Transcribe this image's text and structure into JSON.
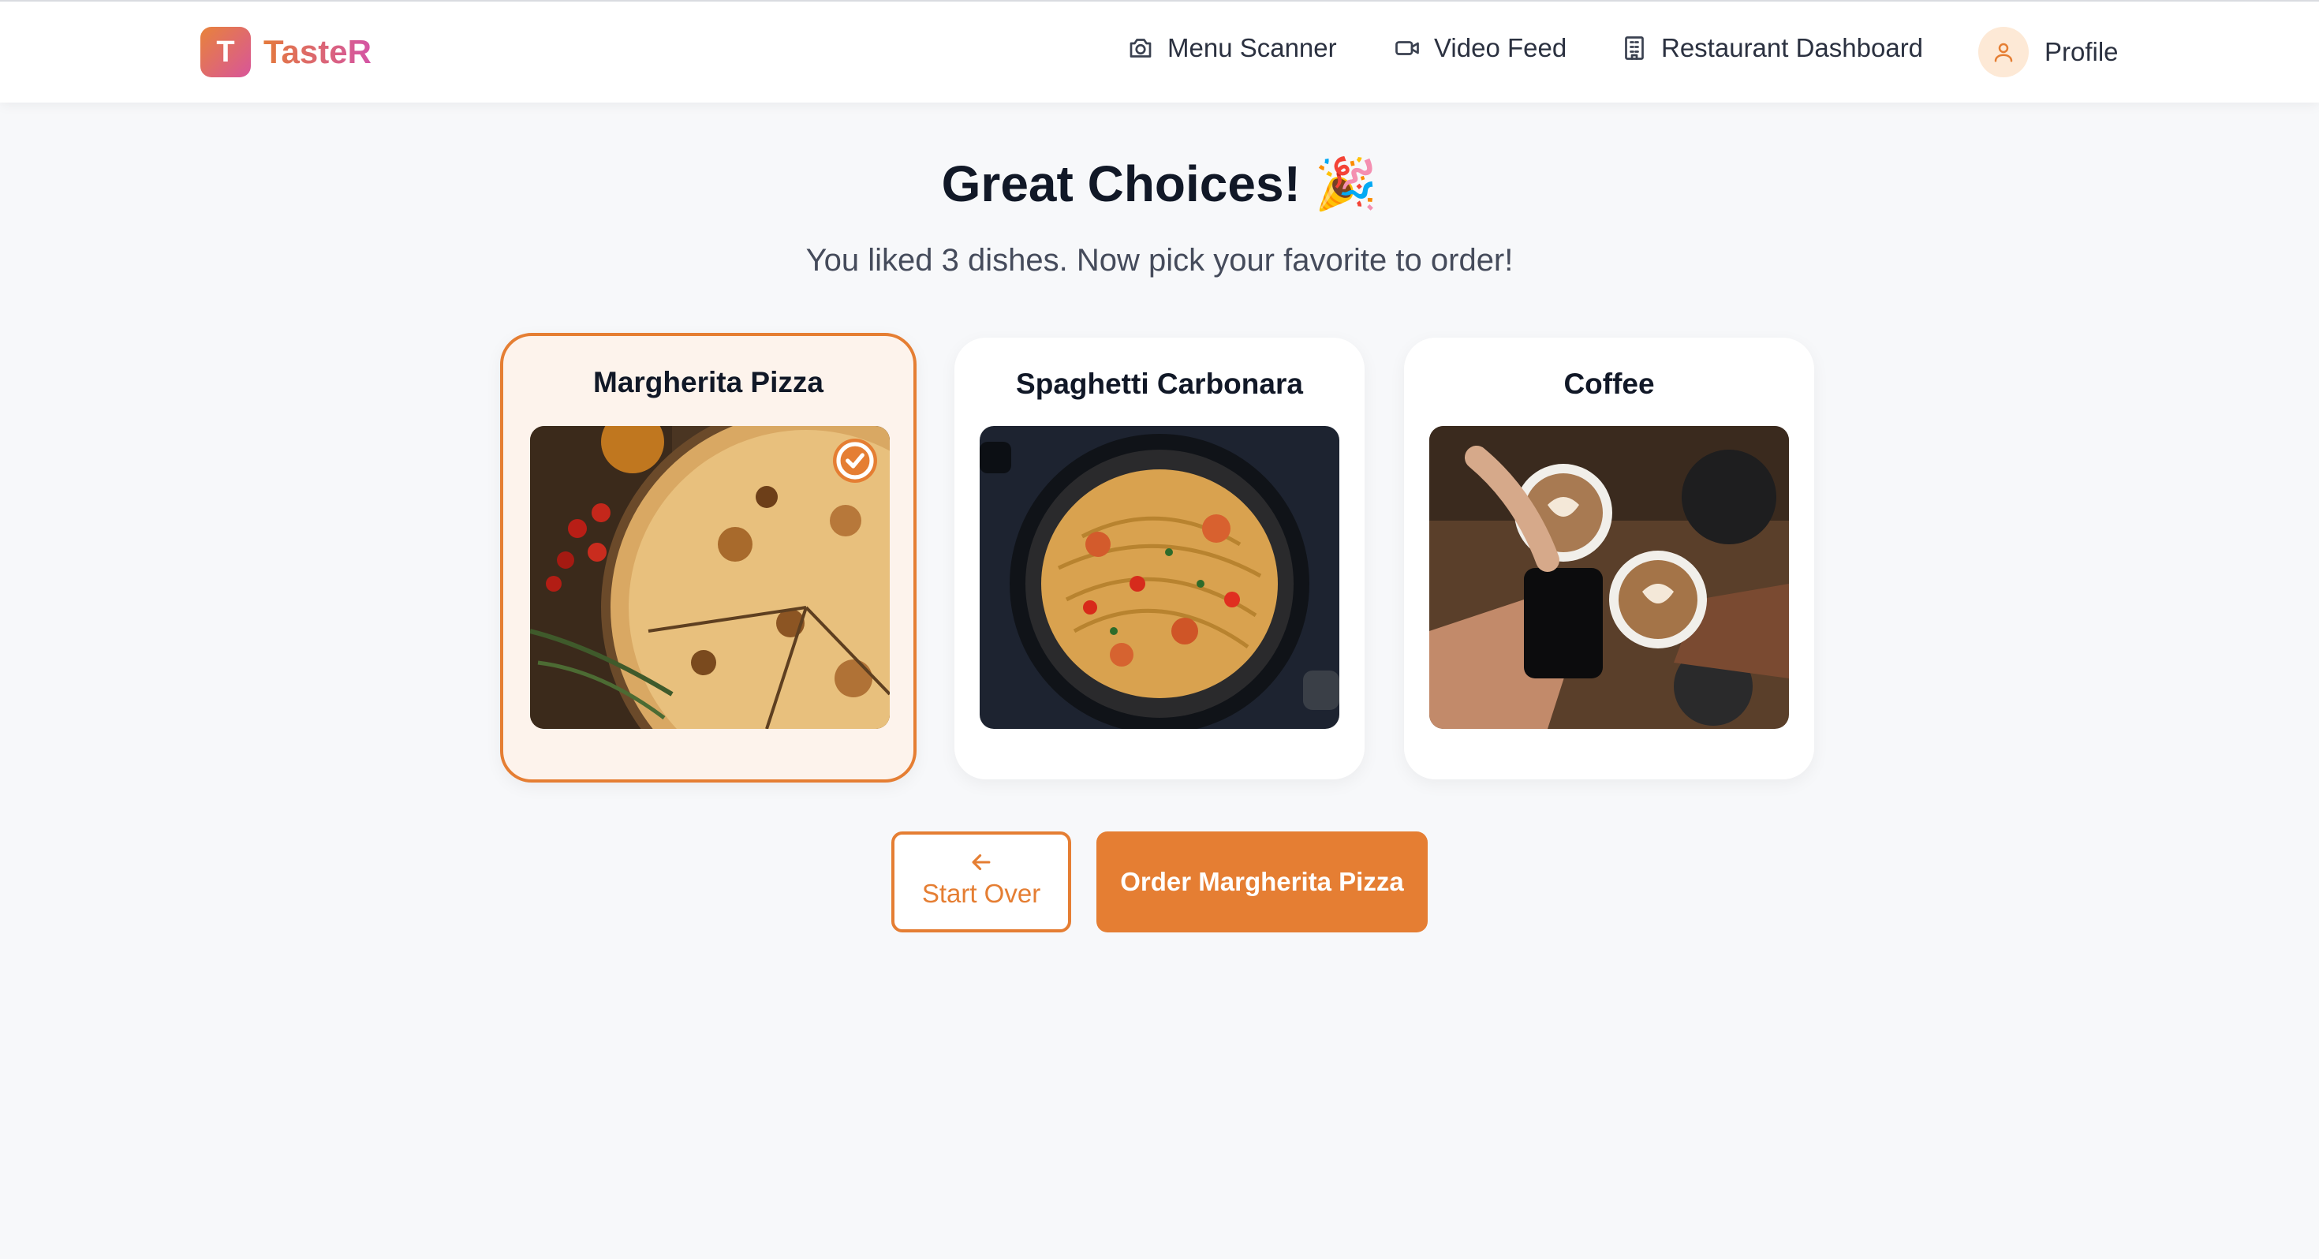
{
  "app": {
    "logo_letter": "T",
    "name": "TasteR"
  },
  "nav": {
    "items": [
      {
        "label": "Menu Scanner",
        "icon": "camera-icon"
      },
      {
        "label": "Video Feed",
        "icon": "video-icon"
      },
      {
        "label": "Restaurant Dashboard",
        "icon": "building-icon"
      },
      {
        "label": "Profile",
        "icon": "user-icon"
      }
    ]
  },
  "main": {
    "title": "Great Choices! 🎉",
    "subtitle": "You liked 3 dishes. Now pick your favorite to order!",
    "dishes": [
      {
        "name": "Margherita Pizza",
        "selected": true,
        "image": "pizza-photo"
      },
      {
        "name": "Spaghetti Carbonara",
        "selected": false,
        "image": "spaghetti-photo"
      },
      {
        "name": "Coffee",
        "selected": false,
        "image": "coffee-photo"
      }
    ]
  },
  "actions": {
    "start_over": "Start Over",
    "order": "Order Margherita Pizza"
  },
  "colors": {
    "accent": "#e57e33",
    "selected_bg": "#fdf3ec",
    "page_bg": "#f7f8fa"
  }
}
